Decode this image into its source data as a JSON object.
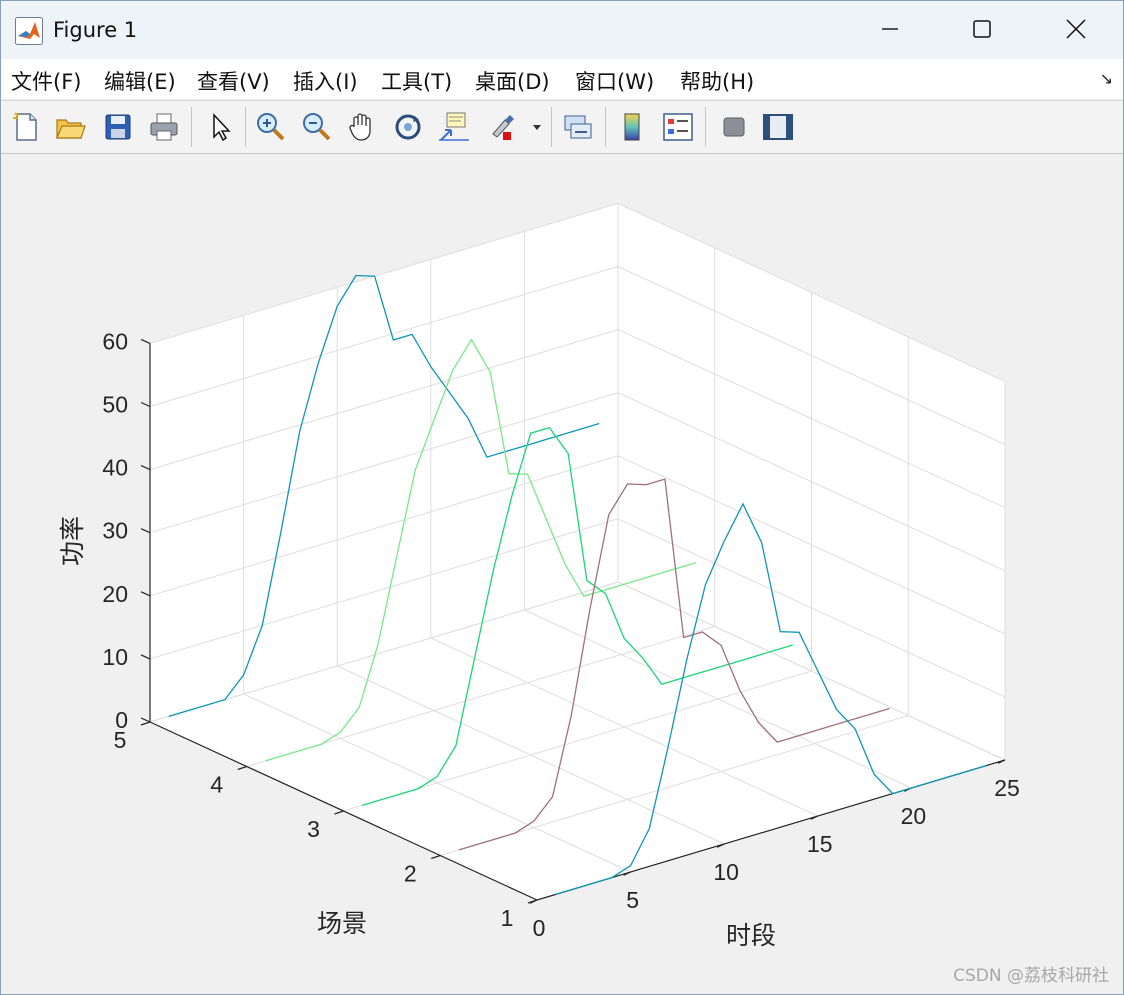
{
  "window": {
    "title": "Figure 1",
    "minimize_glyph": "—",
    "maximize_glyph": "☐",
    "close_glyph": "✕"
  },
  "menu": [
    {
      "label": "文件(F)"
    },
    {
      "label": "编辑(E)"
    },
    {
      "label": "查看(V)"
    },
    {
      "label": "插入(I)"
    },
    {
      "label": "工具(T)"
    },
    {
      "label": "桌面(D)"
    },
    {
      "label": "窗口(W)"
    },
    {
      "label": "帮助(H)"
    }
  ],
  "menu_dock_glyph": "↘",
  "toolbar": [
    {
      "name": "new-figure-icon"
    },
    {
      "name": "open-file-icon"
    },
    {
      "name": "save-icon"
    },
    {
      "name": "print-icon"
    },
    {
      "name": "pointer-icon"
    },
    {
      "name": "zoom-in-icon"
    },
    {
      "name": "zoom-out-icon"
    },
    {
      "name": "pan-hand-icon"
    },
    {
      "name": "rotate-3d-icon"
    },
    {
      "name": "data-cursor-icon"
    },
    {
      "name": "brush-icon"
    },
    {
      "name": "link-plot-icon"
    },
    {
      "name": "colorbar-icon"
    },
    {
      "name": "legend-icon"
    },
    {
      "name": "hide-plot-tools-icon"
    },
    {
      "name": "show-plot-tools-icon"
    }
  ],
  "colors": {
    "series": [
      "#0d97b4",
      "#79e887",
      "#19d673",
      "#a0707f",
      "#0d97b4"
    ],
    "grid": "#dedede",
    "axis": "#262626"
  },
  "chart_data": {
    "type": "line",
    "subtype": "3d-line",
    "xlabel": "时段",
    "ylabel": "场景",
    "zlabel": "功率",
    "xlim": [
      0,
      25
    ],
    "ylim": [
      1,
      5
    ],
    "zlim": [
      0,
      60
    ],
    "xticks": [
      "0",
      "5",
      "10",
      "15",
      "20",
      "25"
    ],
    "yticks": [
      "1",
      "2",
      "3",
      "4",
      "5"
    ],
    "zticks": [
      "0",
      "10",
      "20",
      "30",
      "40",
      "50",
      "60"
    ],
    "grid": true,
    "series": [
      {
        "scenario": 5,
        "x": [
          1,
          2,
          3,
          4,
          5,
          6,
          7,
          8,
          9,
          10,
          11,
          12,
          13,
          14,
          15,
          16,
          17,
          18,
          19,
          20,
          21,
          22,
          23,
          24
        ],
        "values": [
          0,
          0,
          0,
          0,
          3,
          10,
          24,
          39,
          49,
          57,
          61,
          60,
          49,
          49,
          43,
          38,
          33,
          26,
          26,
          26,
          26,
          26,
          26,
          26
        ]
      },
      {
        "scenario": 4,
        "x": [
          1,
          2,
          3,
          4,
          5,
          6,
          7,
          8,
          9,
          10,
          11,
          12,
          13,
          14,
          15,
          16,
          17,
          18,
          19,
          20,
          21,
          22,
          23,
          24
        ],
        "values": [
          0,
          0,
          0,
          0,
          1,
          4,
          13,
          26,
          39,
          46,
          53,
          57,
          51,
          34,
          33,
          25,
          17,
          11,
          11,
          11,
          11,
          11,
          11,
          11
        ]
      },
      {
        "scenario": 3,
        "x": [
          1,
          2,
          3,
          4,
          5,
          6,
          7,
          8,
          9,
          10,
          11,
          12,
          13,
          14,
          15,
          16,
          17,
          18,
          19,
          20,
          21,
          22,
          23,
          24
        ],
        "values": [
          0,
          0,
          0,
          0,
          1,
          5,
          18,
          31,
          42,
          51,
          51,
          46,
          25,
          22,
          14,
          10,
          5,
          5,
          5,
          5,
          5,
          5,
          5,
          5
        ]
      },
      {
        "scenario": 2,
        "x": [
          1,
          2,
          3,
          4,
          5,
          6,
          7,
          8,
          9,
          10,
          11,
          12,
          13,
          14,
          15,
          16,
          17,
          18,
          19,
          20,
          21,
          22,
          23,
          24
        ],
        "values": [
          0,
          0,
          0,
          0,
          1,
          4,
          16,
          32,
          46,
          50,
          49,
          49,
          23,
          23,
          20,
          12,
          6,
          2,
          2,
          2,
          2,
          2,
          2,
          2
        ]
      },
      {
        "scenario": 1,
        "x": [
          1,
          2,
          3,
          4,
          5,
          6,
          7,
          8,
          9,
          10,
          11,
          12,
          13,
          14,
          15,
          16,
          17,
          18,
          19,
          20,
          21,
          22,
          23,
          24
        ],
        "values": [
          0,
          0,
          0,
          0,
          1,
          6,
          18,
          31,
          42,
          48,
          53,
          46,
          31,
          30,
          23,
          16,
          12,
          4,
          0,
          0,
          0,
          0,
          0,
          0
        ]
      }
    ]
  },
  "watermark": "CSDN @荔枝科研社"
}
